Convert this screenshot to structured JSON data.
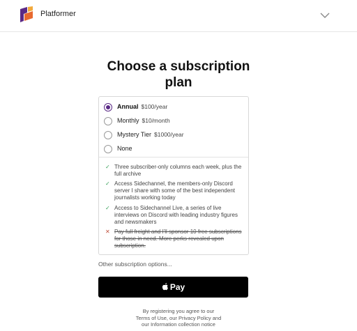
{
  "header": {
    "brand": "Platformer",
    "menu_icon": "chevron-down-icon",
    "logo_colors": [
      "#5b2a86",
      "#e8692f",
      "#f2a93b"
    ]
  },
  "page": {
    "title": "Choose a subscription plan"
  },
  "plans": [
    {
      "name": "Annual",
      "price": "$100/year",
      "selected": true
    },
    {
      "name": "Monthly",
      "price": "$10/month",
      "selected": false
    },
    {
      "name": "Mystery Tier",
      "price": "$1000/year",
      "selected": false
    },
    {
      "name": "None",
      "price": "",
      "selected": false
    }
  ],
  "perks": [
    {
      "icon": "check-icon",
      "text": "Three subscriber-only columns each week, plus the full archive",
      "included": true
    },
    {
      "icon": "check-icon",
      "text": "Access Sidechannel, the members-only Discord server I share with some of the best independent journalists working today",
      "included": true
    },
    {
      "icon": "check-icon",
      "text": "Access to Sidechannel Live, a series of live interviews on Discord with leading industry figures and newsmakers",
      "included": true
    },
    {
      "icon": "x-icon",
      "text": "Pay full freight and I'll sponsor 10 free subscriptions for those in need. More perks revealed upon subscription.",
      "included": false
    }
  ],
  "other_options": "Other subscription options...",
  "pay_button": {
    "label": "Pay",
    "icon": "apple-icon"
  },
  "legal": {
    "line1": "By registering you agree to our",
    "line2": "Terms of Use, our Privacy Policy and",
    "line3": "our Information collection notice"
  },
  "colors": {
    "accent": "#5b2a86",
    "check": "#3aa05a",
    "cross": "#c0503c"
  }
}
